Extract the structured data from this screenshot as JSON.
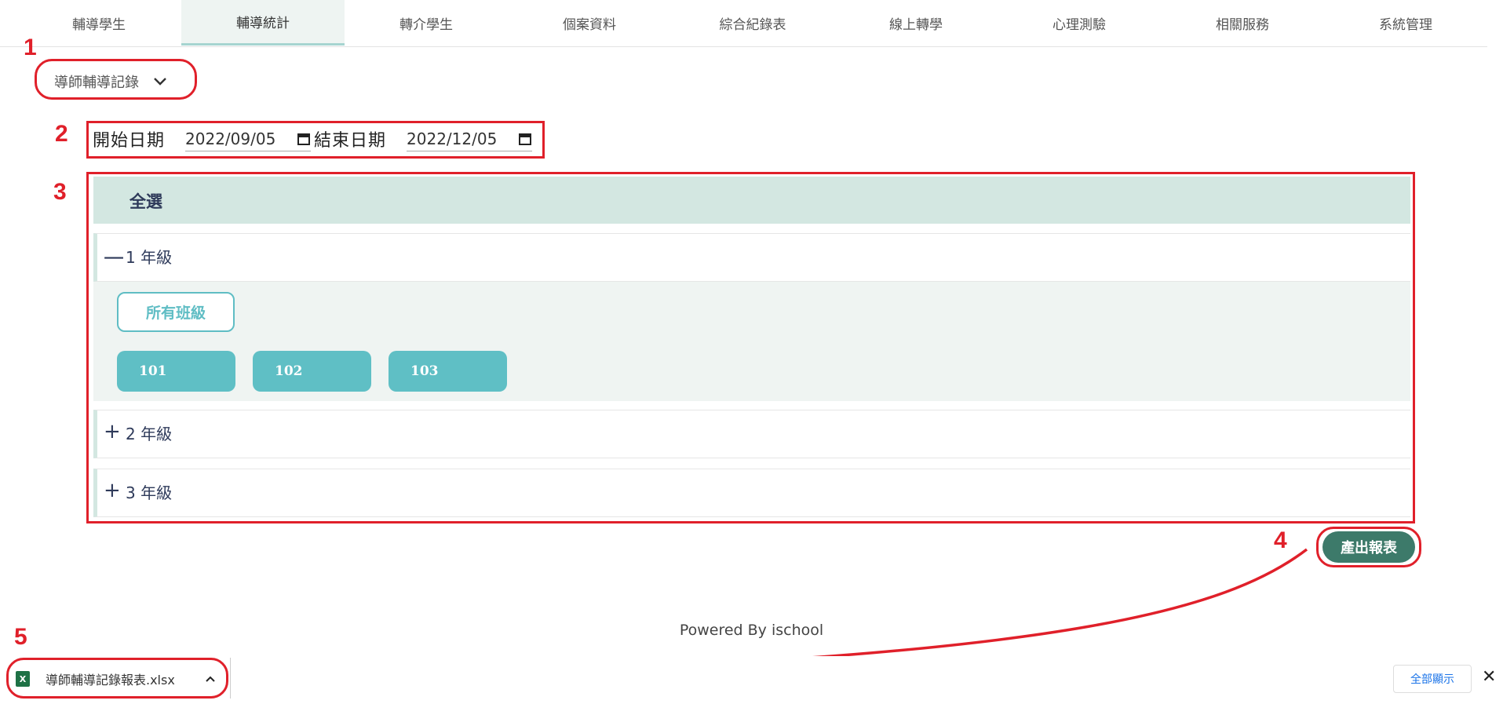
{
  "nav": {
    "tabs": [
      {
        "label": "輔導學生"
      },
      {
        "label": "輔導統計",
        "active": true
      },
      {
        "label": "轉介學生"
      },
      {
        "label": "個案資料"
      },
      {
        "label": "綜合紀錄表"
      },
      {
        "label": "線上轉學"
      },
      {
        "label": "心理測驗"
      },
      {
        "label": "相關服務"
      },
      {
        "label": "系統管理"
      }
    ]
  },
  "report_type": {
    "value": "導師輔導記錄",
    "icon": "chevron-down-icon"
  },
  "dates": {
    "start_label": "開始日期",
    "start_value": "2022/09/05",
    "end_label": "結束日期",
    "end_value": "2022/12/05",
    "calendar_icon": "calendar-icon"
  },
  "selection": {
    "select_all": "全選",
    "grades": [
      {
        "sign": "一",
        "label": "1 年級",
        "expanded": true
      },
      {
        "sign": "+",
        "label": "2 年級",
        "expanded": false
      },
      {
        "sign": "+",
        "label": "3 年級",
        "expanded": false
      }
    ],
    "all_classes": "所有班級",
    "classes": [
      "101",
      "102",
      "103"
    ]
  },
  "generate_button": "產出報表",
  "footer": "Powered By ischool",
  "download": {
    "file_name": "導師輔導記錄報表.xlsx",
    "file_icon": "excel-file-icon",
    "show_all": "全部顯示",
    "close": "✕"
  },
  "annotations": {
    "numbers": [
      "1",
      "2",
      "3",
      "4",
      "5"
    ],
    "color": "#e0202a"
  },
  "colors": {
    "accent_teal": "#5fbfc5",
    "header_green": "#d3e7e1",
    "button_green": "#3d7a6a"
  }
}
